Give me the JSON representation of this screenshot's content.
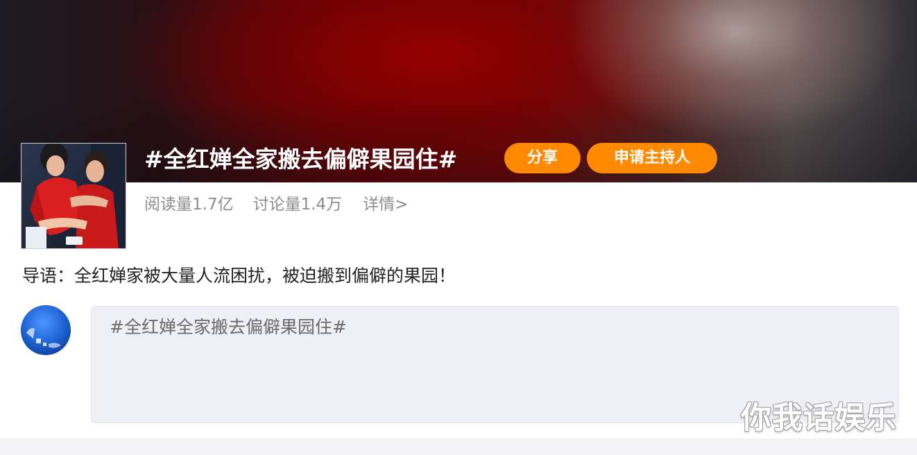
{
  "topic": {
    "title": "#全红婵全家搬去偏僻果园住#",
    "share_label": "分享",
    "apply_host_label": "申请主持人"
  },
  "stats": {
    "read": "阅读量1.7亿",
    "discuss": "讨论量1.4万",
    "detail": "详情>"
  },
  "intro": {
    "text": "导语：全红婵家被大量人流困扰，被迫搬到偏僻的果园！"
  },
  "compose": {
    "value": "#全红婵全家搬去偏僻果园住#"
  },
  "watermark": {
    "text": "你我话娱乐"
  },
  "colors": {
    "accent_orange": "#ff8a00",
    "banner_red": "#7a0606",
    "muted_text": "#8c8c8c",
    "compose_bg": "#eef0f5"
  },
  "icons": {
    "cover": "topic-cover-photo",
    "avatar": "user-avatar"
  }
}
